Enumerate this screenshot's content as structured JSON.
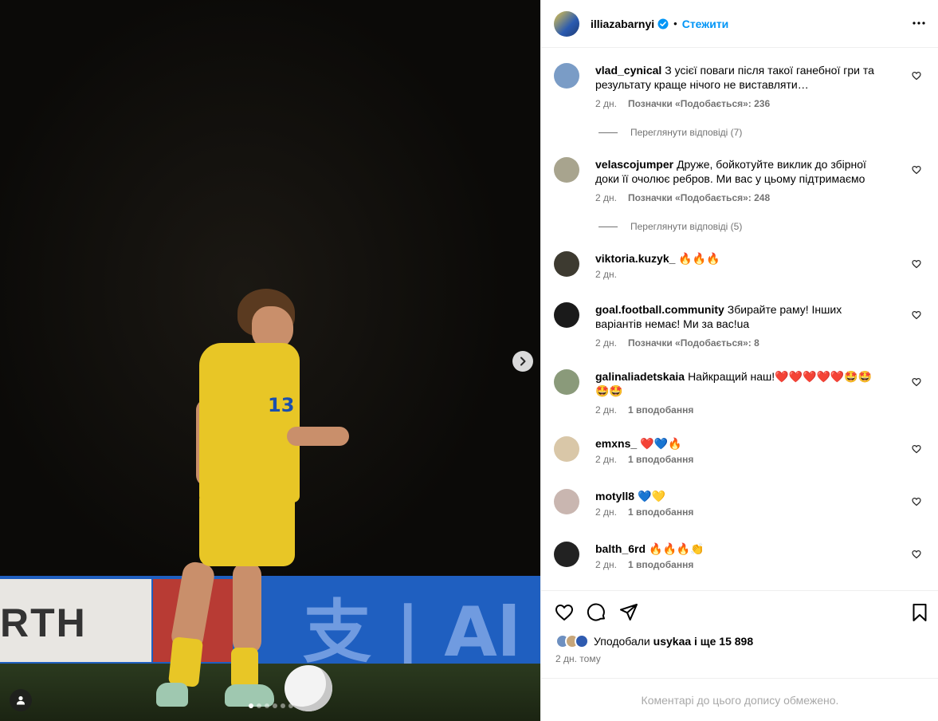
{
  "photo": {
    "banner_text": "RTH",
    "banner_text2": "支 | Al",
    "jersey_number": "13",
    "slide_count": 6,
    "active_slide": 0
  },
  "header": {
    "username": "illiazabarnyi",
    "verified": true,
    "separator": "•",
    "follow_label": "Стежити"
  },
  "comments": [
    {
      "username": "vlad_cynical",
      "text": "З усієї поваги після такої ганебної гри та результату краще нічого не виставляти…",
      "time": "2 дн.",
      "likes": "Позначки «Подобається»: 236",
      "replies": "Переглянути відповіді (7)",
      "avatar_color": "#7a9cc6"
    },
    {
      "username": "velascojumper",
      "text": "Друже, бойкотуйте виклик до збірної доки її очолює ребров. Ми вас у цьому підтримаємо",
      "time": "2 дн.",
      "likes": "Позначки «Подобається»: 248",
      "replies": "Переглянути відповіді (5)",
      "avatar_color": "#a8a48e"
    },
    {
      "username": "viktoria.kuzyk_",
      "text": "🔥🔥🔥",
      "time": "2 дн.",
      "likes": "",
      "replies": "",
      "avatar_color": "#3d3a30"
    },
    {
      "username": "goal.football.community",
      "text": "Збирайте раму! Інших варіантів немає! Ми за вас!ua",
      "time": "2 дн.",
      "likes": "Позначки «Подобається»: 8",
      "replies": "",
      "avatar_color": "#1a1a1a"
    },
    {
      "username": "galinaliadetskaia",
      "text": "Найкращий наш!❤️❤️❤️❤️❤️🤩🤩🤩🤩",
      "time": "2 дн.",
      "likes": "1 вподобання",
      "replies": "",
      "avatar_color": "#8a9a7a"
    },
    {
      "username": "emxns_",
      "text": "❤️💙🔥",
      "time": "2 дн.",
      "likes": "1 вподобання",
      "replies": "",
      "avatar_color": "#d9c7a8"
    },
    {
      "username": "motyll8",
      "text": "💙💛",
      "time": "2 дн.",
      "likes": "1 вподобання",
      "replies": "",
      "avatar_color": "#c9b6b0"
    },
    {
      "username": "balth_6rd",
      "text": "🔥🔥🔥👏",
      "time": "2 дн.",
      "likes": "1 вподобання",
      "replies": "",
      "avatar_color": "#222"
    }
  ],
  "actions": {
    "liked_by_prefix": "Уподобали",
    "liked_by_user": "usykaa",
    "liked_by_suffix": "і ще 15 898",
    "post_time": "2 дн. тому"
  },
  "comments_limited": "Коментарі до цього допису обмежено.",
  "icons": [
    "chevron-right-icon",
    "user-tag-icon",
    "more-icon",
    "heart-icon",
    "comment-icon",
    "share-icon",
    "bookmark-icon",
    "verified-icon"
  ],
  "colors": {
    "accent": "#0095f6",
    "meta": "#737373",
    "border": "#efefef"
  }
}
